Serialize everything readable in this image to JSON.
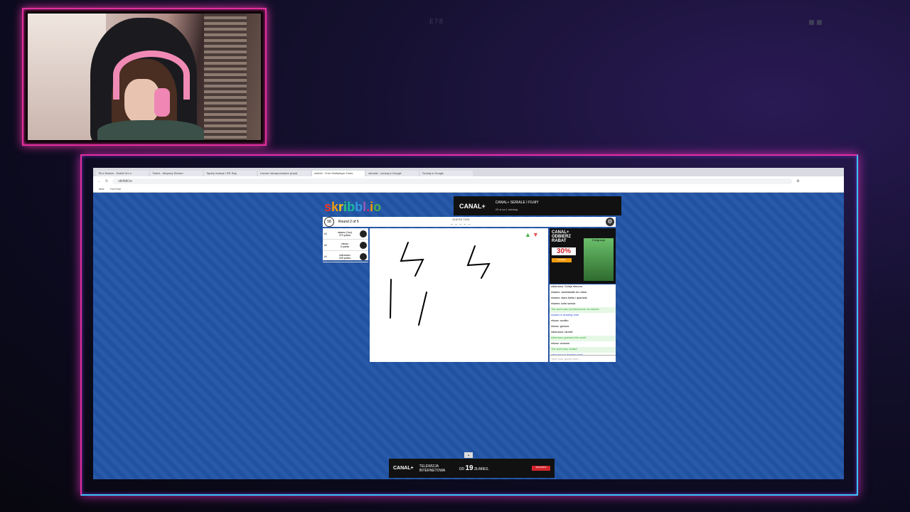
{
  "overlay": {
    "code": "E78"
  },
  "browser": {
    "tabs": [
      "Tilt a Rasion - Rabid Grn n",
      "Twitch - Aktywny Stream",
      "Tapety reakcje i RE Rap",
      "Lisowe niezapomniane przysl",
      "skribbl - Free Multiplayer Draw",
      "zdrowie - szukaj w Google",
      "Szukaj w Google"
    ],
    "active_tab": 4,
    "url": "skribbl.io",
    "bookmarks": [
      "Mail",
      "YouTube"
    ]
  },
  "game": {
    "logo": "skribbl.io",
    "logo_colors": [
      "#e6392b",
      "#f39c12",
      "#f1c40f",
      "#2ecc71",
      "#1abc9c",
      "#3498db",
      "#9b59b6",
      "#e91e63",
      "#ff9800",
      "#4caf50"
    ],
    "timer": "58",
    "round": "Round 2 of 5",
    "guess_label": "GUESS THIS",
    "word_hint": "_ _ _ _ _",
    "players": [
      {
        "rank": "#2",
        "name": "nisamo (You)",
        "points": "370 points"
      },
      {
        "rank": "#2",
        "name": "nikosz",
        "points": "0 points"
      },
      {
        "rank": "#1",
        "name": "odkurzacz",
        "points": "425 points"
      }
    ],
    "chat": [
      {
        "text": "odkurzacz: Dzieje ribeuna",
        "cls": ""
      },
      {
        "text": "nisamo: zadzwtsiale do robka",
        "cls": ""
      },
      {
        "text": "nisamo: stara bieba i aparaulk",
        "cls": ""
      },
      {
        "text": "nisamo: kotsi sznula",
        "cls": ""
      },
      {
        "text": "The word was 'przeistoczone' as dowezi",
        "cls": "g"
      },
      {
        "text": "nisamo is drawing now!",
        "cls": "b"
      },
      {
        "text": "nikosz: sznilko",
        "cls": ""
      },
      {
        "text": "nikosz: gruisza",
        "cls": ""
      },
      {
        "text": "odkurzacz: landeli",
        "cls": ""
      },
      {
        "text": "odkurzacz guessed the word!",
        "cls": "g"
      },
      {
        "text": "nikosz: wromse",
        "cls": ""
      },
      {
        "text": "The word was 'znakia'",
        "cls": "g"
      },
      {
        "text": "odkurzacz is drawing now!",
        "cls": "b"
      }
    ],
    "chat_placeholder": "Type your guess here..."
  },
  "ads": {
    "top": {
      "brand": "CANAL+",
      "headline": "CANAL+ SERIALE I FILMY",
      "sub": "29 zł za 1 miesiąc"
    },
    "side": {
      "brand": "CANAL+",
      "line1": "ODBIERZ",
      "line2": "RABAT",
      "percent": "30%",
      "cta": "Sprawdź",
      "show": "Emigracja"
    },
    "bottom": {
      "brand": "CANAL+",
      "headline": "TELEWIZJA INTERNETOWA",
      "price_prefix": "OD",
      "price": "19",
      "price_unit": "ZŁ/MIES.",
      "cta": "SPRAWDŹ"
    }
  }
}
